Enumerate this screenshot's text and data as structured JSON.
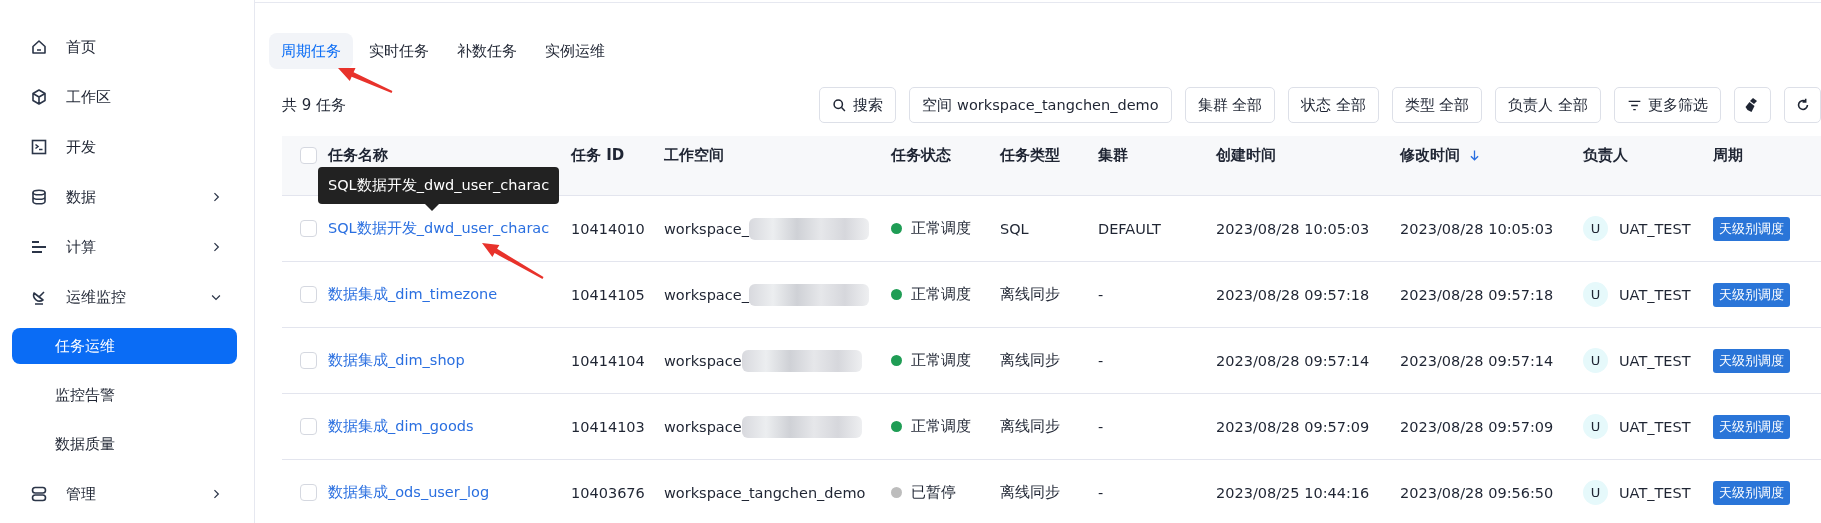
{
  "sidebar": {
    "items": [
      {
        "label": "首页",
        "selected": false
      },
      {
        "label": "工作区",
        "selected": false
      },
      {
        "label": "开发",
        "selected": false
      },
      {
        "label": "数据",
        "selected": false,
        "expanded": false
      },
      {
        "label": "计算",
        "selected": false,
        "expanded": false
      },
      {
        "label": "运维监控",
        "selected": false,
        "expanded": true,
        "children": [
          {
            "label": "任务运维",
            "selected": true
          },
          {
            "label": "监控告警",
            "selected": false
          },
          {
            "label": "数据质量",
            "selected": false
          }
        ]
      },
      {
        "label": "管理",
        "selected": false,
        "expanded": false
      }
    ]
  },
  "tabs": [
    {
      "label": "周期任务",
      "selected": true
    },
    {
      "label": "实时任务",
      "selected": false
    },
    {
      "label": "补数任务",
      "selected": false
    },
    {
      "label": "实例运维",
      "selected": false
    }
  ],
  "task_count": "共 9 任务",
  "filters": [
    {
      "kind": "search",
      "label": "搜索"
    },
    {
      "kind": "select",
      "label": "空间 workspace_tangchen_demo"
    },
    {
      "kind": "select",
      "label": "集群 全部"
    },
    {
      "kind": "select",
      "label": "状态 全部"
    },
    {
      "kind": "select",
      "label": "类型 全部"
    },
    {
      "kind": "select",
      "label": "负责人 全部"
    },
    {
      "kind": "more",
      "label": "更多筛选"
    }
  ],
  "table": {
    "select_all": {
      "checked": false
    },
    "columns": [
      {
        "label": "任务名称",
        "sorted": false
      },
      {
        "label": "任务 ID",
        "sorted": false
      },
      {
        "label": "工作空间",
        "sorted": false
      },
      {
        "label": "任务状态",
        "sorted": false
      },
      {
        "label": "任务类型",
        "sorted": false
      },
      {
        "label": "集群",
        "sorted": false
      },
      {
        "label": "创建时间",
        "sorted": false
      },
      {
        "label": "修改时间",
        "sorted": true
      },
      {
        "label": "负责人",
        "sorted": false
      },
      {
        "label": "周期",
        "sorted": false
      }
    ],
    "rows": [
      {
        "checked": false,
        "name": "SQL数据开发_dwd_user_charac",
        "id": "10414010",
        "workspace": "workspace_",
        "blurred": true,
        "status": "正常调度",
        "color": "#1f9d55",
        "type": "SQL",
        "cluster": "DEFAULT",
        "created": "2023/08/28 10:05:03",
        "modified": "2023/08/28 10:05:03",
        "avatar": "U",
        "owner": "UAT_TEST",
        "period": "天级别调度"
      },
      {
        "checked": false,
        "name": "数据集成_dim_timezone",
        "id": "10414105",
        "workspace": "workspace_",
        "blurred": true,
        "status": "正常调度",
        "color": "#1f9d55",
        "type": "离线同步",
        "cluster": "-",
        "created": "2023/08/28 09:57:18",
        "modified": "2023/08/28 09:57:18",
        "avatar": "U",
        "owner": "UAT_TEST",
        "period": "天级别调度"
      },
      {
        "checked": false,
        "name": "数据集成_dim_shop",
        "id": "10414104",
        "workspace": "workspace",
        "blurred": true,
        "status": "正常调度",
        "color": "#1f9d55",
        "type": "离线同步",
        "cluster": "-",
        "created": "2023/08/28 09:57:14",
        "modified": "2023/08/28 09:57:14",
        "avatar": "U",
        "owner": "UAT_TEST",
        "period": "天级别调度"
      },
      {
        "checked": false,
        "name": "数据集成_dim_goods",
        "id": "10414103",
        "workspace": "workspace",
        "blurred": true,
        "status": "正常调度",
        "color": "#1f9d55",
        "type": "离线同步",
        "cluster": "-",
        "created": "2023/08/28 09:57:09",
        "modified": "2023/08/28 09:57:09",
        "avatar": "U",
        "owner": "UAT_TEST",
        "period": "天级别调度"
      },
      {
        "checked": false,
        "name": "数据集成_ods_user_log",
        "id": "10403676",
        "workspace": "workspace_tangchen_demo",
        "blurred": false,
        "status": "已暂停",
        "color": "#bdbdbd",
        "type": "离线同步",
        "cluster": "-",
        "created": "2023/08/25 10:44:16",
        "modified": "2023/08/28 09:56:50",
        "avatar": "U",
        "owner": "UAT_TEST",
        "period": "天级别调度"
      }
    ]
  },
  "tooltip": {
    "text": "SQL数据开发_dwd_user_charac"
  }
}
